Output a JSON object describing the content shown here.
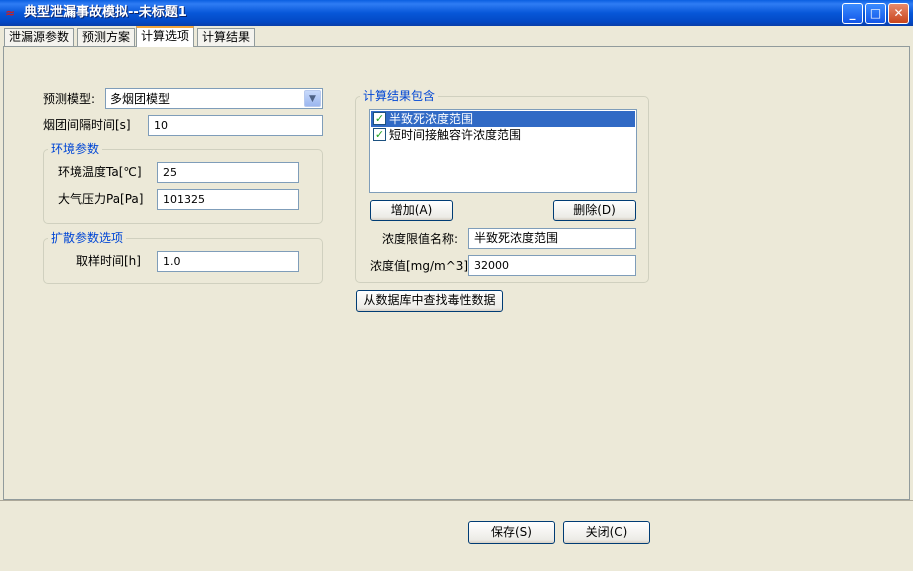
{
  "window": {
    "title": "典型泄漏事故模拟--未标题1",
    "app_icon": "leak-sim-app-icon"
  },
  "titlebar_buttons": {
    "minimize": "_",
    "maximize": "□",
    "close": "✕"
  },
  "tabs": [
    {
      "label": "泄漏源参数",
      "active": false
    },
    {
      "label": "预测方案",
      "active": false
    },
    {
      "label": "计算选项",
      "active": true
    },
    {
      "label": "计算结果",
      "active": false
    }
  ],
  "model": {
    "label": "预测模型:",
    "value": "多烟团模型",
    "icon": "chevron-down-icon"
  },
  "interval": {
    "label": "烟团间隔时间[s]",
    "value": "10"
  },
  "env": {
    "title": "环境参数",
    "temp_label": "环境温度Ta[℃]",
    "temp_value": "25",
    "pressure_label": "大气压力Pa[Pa]",
    "pressure_value": "101325"
  },
  "diffusion": {
    "title": "扩散参数选项",
    "sample_label": "取样时间[h]",
    "sample_value": "1.0"
  },
  "results": {
    "title": "计算结果包含",
    "items": [
      {
        "label": "半致死浓度范围",
        "checked": true,
        "selected": true
      },
      {
        "label": "短时间接触容许浓度范围",
        "checked": true,
        "selected": false
      }
    ],
    "add_button": "增加(A)",
    "delete_button": "删除(D)",
    "name_label": "浓度限值名称:",
    "name_value": "半致死浓度范围",
    "value_label": "浓度值[mg/m^3]:",
    "value_value": "32000"
  },
  "lookup_button": "从数据库中查找毒性数据",
  "footer": {
    "save_button": "保存(S)",
    "close_button": "关闭(C)"
  },
  "colors": {
    "titlebar": "#0757d8",
    "group_title": "#0046d5",
    "selection": "#316ac5",
    "panel": "#ece9d8"
  }
}
